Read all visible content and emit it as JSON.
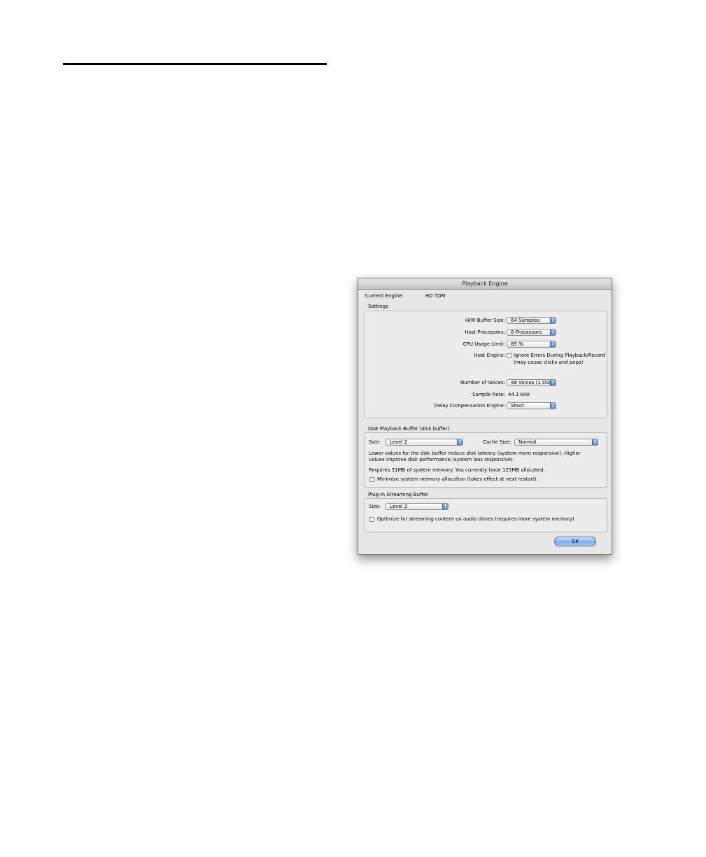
{
  "window": {
    "title": "Playback Engine"
  },
  "current_engine": {
    "label": "Current Engine:",
    "value": "HD TDM"
  },
  "settings": {
    "group_label": "Settings",
    "hw_buffer": {
      "label": "H/W Buffer Size:",
      "value": "64 Samples"
    },
    "host_processors": {
      "label": "Host Processors:",
      "value": "8 Processors"
    },
    "cpu_usage": {
      "label": "CPU Usage Limit:",
      "value": "85 %"
    },
    "host_engine": {
      "label": "Host Engine:",
      "checkbox_label": "Ignore Errors During Playback/Record",
      "note": "(may cause clicks and pops)"
    },
    "voices": {
      "label": "Number of Voices:",
      "value": "48 Voices (1 DSP)"
    },
    "sample_rate": {
      "label": "Sample Rate:",
      "value": "44.1 kHz"
    },
    "delay_comp": {
      "label": "Delay Compensation Engine:",
      "value": "Short"
    }
  },
  "dae_buffer": {
    "group_label": "DAE Playback Buffer (disk buffer)",
    "size_label": "Size:",
    "size_value": "Level 2",
    "cache_label": "Cache Size:",
    "cache_value": "Normal",
    "desc_line1": "Lower values for the disk buffer reduce disk latency (system more responsive).  Higher",
    "desc_line2": "values improve disk performance (system less responsive).",
    "memory_note": "Requires 31MB of system memory. You currently have 125MB allocated.",
    "minimize_label": "Minimize system memory allocation (takes effect at next restart)."
  },
  "plugin_buffer": {
    "group_label": "Plug-In Streaming Buffer",
    "size_label": "Size:",
    "size_value": "Level 2",
    "optimize_label": "Optimize for streaming content on audio drives (requires more system memory)"
  },
  "buttons": {
    "ok": "OK"
  },
  "icons": {
    "popup_arrow": "updown-arrows-icon"
  },
  "colors": {
    "accent": "#3f7fd8",
    "window_bg": "#e6e6e6"
  }
}
